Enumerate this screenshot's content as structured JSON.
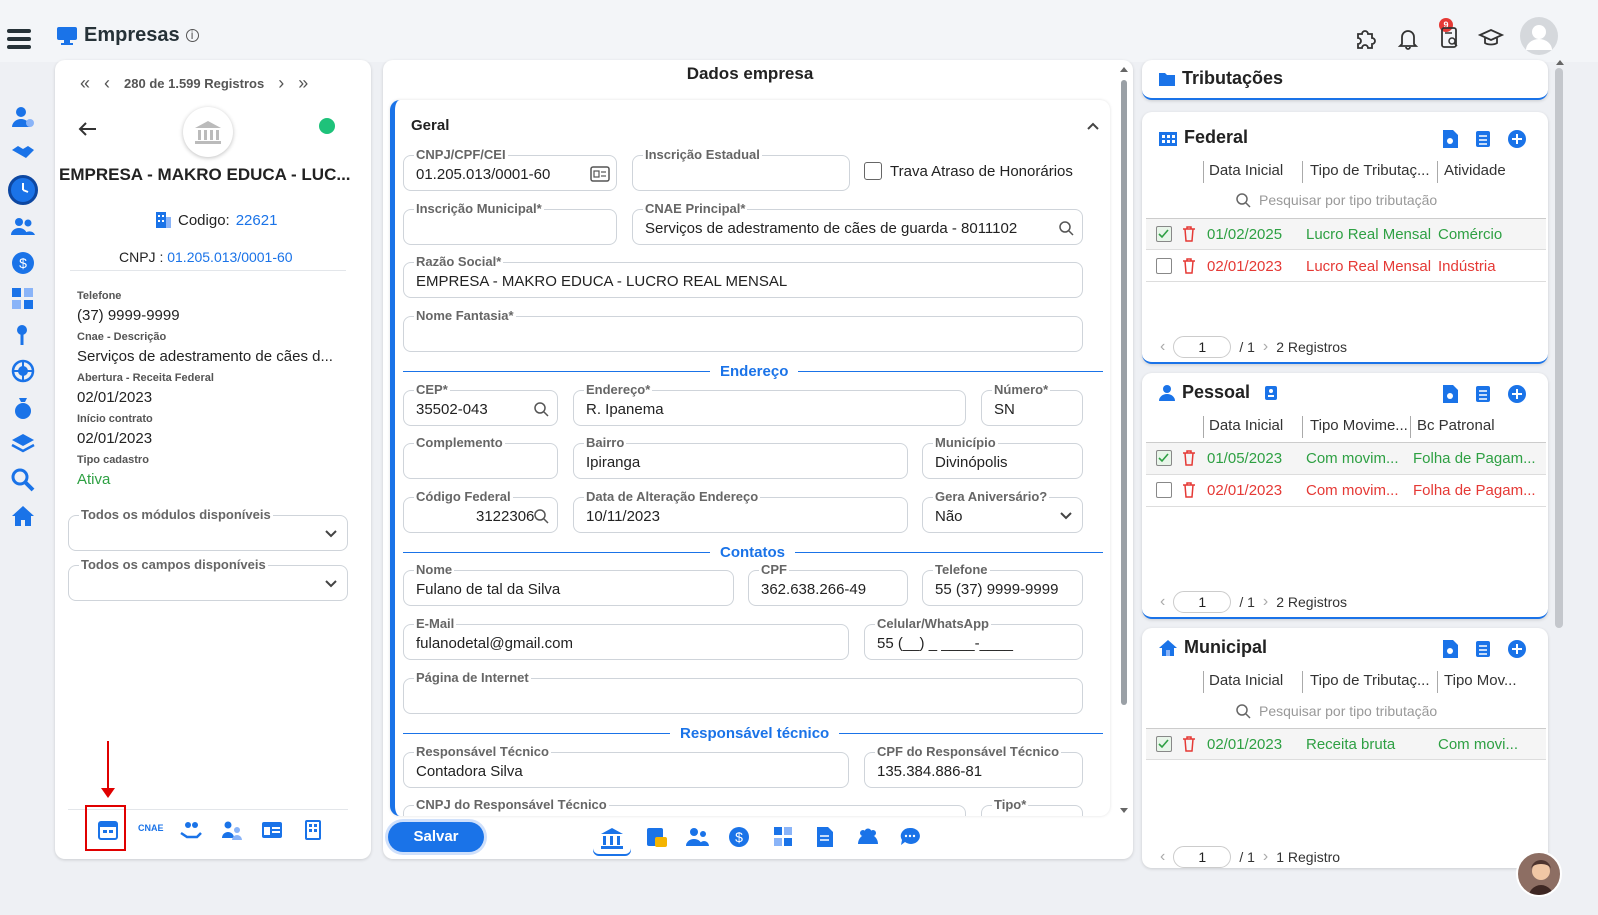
{
  "header": {
    "title": "Empresas",
    "notif_count": "9"
  },
  "left": {
    "nav": {
      "first": "«",
      "prev": "‹",
      "text": "280 de 1.599 Registros",
      "next": "›",
      "last": "»"
    },
    "company_name": "EMPRESA - MAKRO EDUCA - LUC...",
    "codigo_label": "Codigo:",
    "codigo_value": "22621",
    "cnpj_label": "CNPJ :",
    "cnpj_value": "01.205.013/0001-60",
    "info": [
      {
        "label": "Telefone",
        "value": "(37) 9999-9999"
      },
      {
        "label": "Cnae - Descrição",
        "value": "Serviços de adestramento de cães d..."
      },
      {
        "label": "Abertura - Receita Federal",
        "value": "02/01/2023"
      },
      {
        "label": "Início contrato",
        "value": "02/01/2023"
      },
      {
        "label": "Tipo cadastro",
        "value": "Ativa"
      }
    ],
    "select1": "Todos os módulos disponíveis",
    "select2": "Todos os campos disponíveis",
    "cnae_tab": "CNAE"
  },
  "center": {
    "title": "Dados empresa",
    "section_geral": "Geral",
    "fields": {
      "cnpj": {
        "label": "CNPJ/CPF/CEI",
        "value": "01.205.013/0001-60"
      },
      "ie": {
        "label": "Inscrição Estadual",
        "value": ""
      },
      "trava": "Trava Atraso de Honorários",
      "im": {
        "label": "Inscrição Municipal*",
        "value": ""
      },
      "cnae": {
        "label": "CNAE Principal*",
        "value": "Serviços de adestramento de cães de guarda - 8011102"
      },
      "razao": {
        "label": "Razão Social*",
        "value": "EMPRESA - MAKRO EDUCA - LUCRO REAL MENSAL"
      },
      "fantasia": {
        "label": "Nome Fantasia*",
        "value": ""
      },
      "cep": {
        "label": "CEP*",
        "value": "35502-043"
      },
      "endereco": {
        "label": "Endereço*",
        "value": "R. Ipanema"
      },
      "numero": {
        "label": "Número*",
        "value": "SN"
      },
      "complemento": {
        "label": "Complemento",
        "value": ""
      },
      "bairro": {
        "label": "Bairro",
        "value": "Ipiranga"
      },
      "municipio": {
        "label": "Município",
        "value": "Divinópolis"
      },
      "codfed": {
        "label": "Código Federal",
        "value": "3122306"
      },
      "dataalt": {
        "label": "Data de Alteração Endereço",
        "value": "10/11/2023"
      },
      "aniv": {
        "label": "Gera Aniversário?",
        "value": "Não"
      },
      "nome": {
        "label": "Nome",
        "value": "Fulano de tal da Silva"
      },
      "cpf": {
        "label": "CPF",
        "value": "362.638.266-49"
      },
      "tel": {
        "label": "Telefone",
        "value": "55 (37) 9999-9999"
      },
      "email": {
        "label": "E-Mail",
        "value": "fulanodetal@gmail.com"
      },
      "cel": {
        "label": "Celular/WhatsApp",
        "value": "55 (__) _ ____-____"
      },
      "site": {
        "label": "Página de Internet",
        "value": ""
      },
      "resp": {
        "label": "Responsável Técnico",
        "value": "Contadora Silva"
      },
      "cpfresp": {
        "label": "CPF do Responsável Técnico",
        "value": "135.384.886-81"
      },
      "cnpjresp": {
        "label": "CNPJ do Responsável Técnico",
        "value": ""
      },
      "tipo": {
        "label": "Tipo*",
        "value": ""
      }
    },
    "sections": {
      "endereco": "Endereço",
      "contatos": "Contatos",
      "resp": "Responsável técnico"
    },
    "save": "Salvar"
  },
  "right": {
    "title": "Tributações",
    "federal": {
      "title": "Federal",
      "cols": [
        "Data Inicial",
        "Tipo de Tributaç...",
        "Atividade"
      ],
      "search": "Pesquisar por tipo tributação",
      "rows": [
        {
          "date": "01/02/2025",
          "tipo": "Lucro Real Mensal",
          "ativ": "Comércio",
          "status": "green",
          "checked": true
        },
        {
          "date": "02/01/2023",
          "tipo": "Lucro Real Mensal",
          "ativ": "Indústria",
          "status": "red",
          "checked": false
        }
      ],
      "page": "1",
      "total": "/ 1",
      "count": "2 Registros"
    },
    "pessoal": {
      "title": "Pessoal",
      "cols": [
        "Data Inicial",
        "Tipo Movime...",
        "Bc Patronal"
      ],
      "rows": [
        {
          "date": "01/05/2023",
          "tipo": "Com movim...",
          "ativ": "Folha de Pagam...",
          "status": "green",
          "checked": true
        },
        {
          "date": "02/01/2023",
          "tipo": "Com movim...",
          "ativ": "Folha de Pagam...",
          "status": "red",
          "checked": false
        }
      ],
      "page": "1",
      "total": "/ 1",
      "count": "2 Registros"
    },
    "municipal": {
      "title": "Municipal",
      "cols": [
        "Data Inicial",
        "Tipo de Tributaç...",
        "Tipo Mov..."
      ],
      "search": "Pesquisar por tipo tributação",
      "rows": [
        {
          "date": "02/01/2023",
          "tipo": "Receita bruta",
          "ativ": "Com movi...",
          "status": "green",
          "checked": true
        }
      ],
      "page": "1",
      "total": "/ 1",
      "count": "1 Registro"
    }
  },
  "colors": {
    "accent": "#1a73e8",
    "green": "#2ea043",
    "red": "#e53935",
    "highlight": "#e00000"
  }
}
